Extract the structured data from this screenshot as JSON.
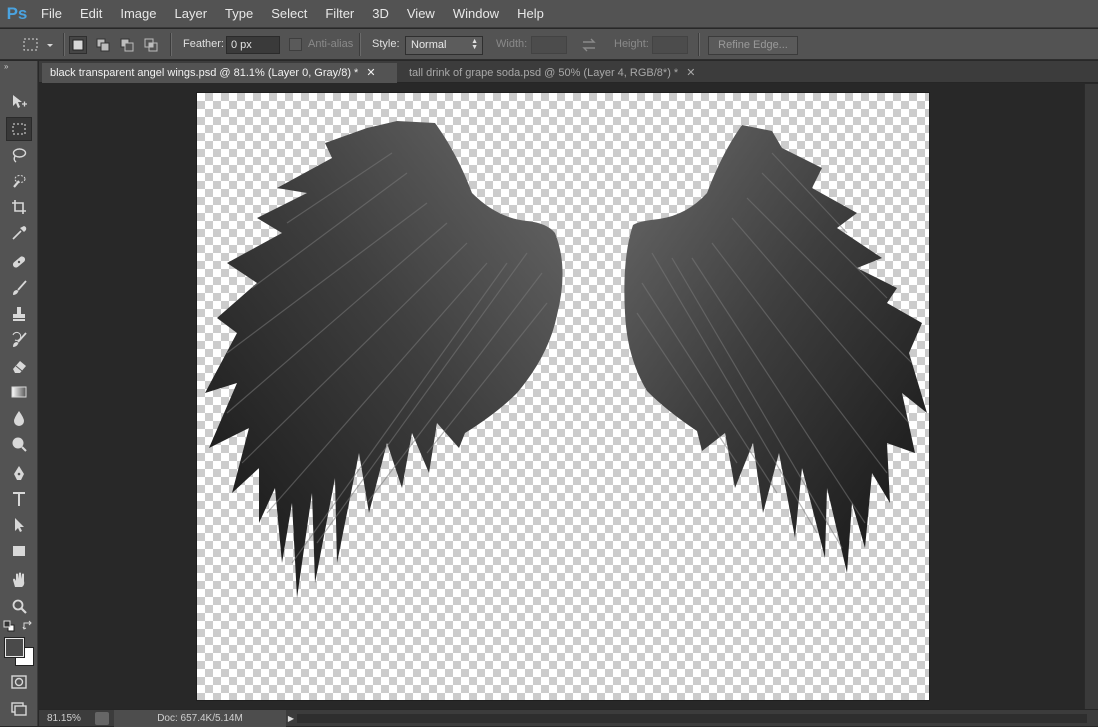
{
  "app": {
    "logo": "Ps"
  },
  "menu": [
    "File",
    "Edit",
    "Image",
    "Layer",
    "Type",
    "Select",
    "Filter",
    "3D",
    "View",
    "Window",
    "Help"
  ],
  "options": {
    "feather_label": "Feather:",
    "feather_value": "0 px",
    "antialias_label": "Anti-alias",
    "style_label": "Style:",
    "style_value": "Normal",
    "width_label": "Width:",
    "height_label": "Height:",
    "refine_edge_label": "Refine Edge..."
  },
  "tabs": [
    {
      "label": "black transparent angel wings.psd @ 81.1% (Layer 0, Gray/8) *",
      "active": true
    },
    {
      "label": "tall drink of grape soda.psd @ 50% (Layer 4, RGB/8*) *",
      "active": false
    }
  ],
  "tools": [
    "move-icon",
    "rectangular-marquee-icon",
    "lasso-icon",
    "quick-selection-icon",
    "crop-icon",
    "eyedropper-icon",
    "spot-healing-icon",
    "brush-icon",
    "clone-stamp-icon",
    "history-brush-icon",
    "eraser-icon",
    "gradient-icon",
    "blur-icon",
    "dodge-icon",
    "pen-icon",
    "type-icon",
    "path-selection-icon",
    "rectangle-icon",
    "hand-icon",
    "zoom-icon"
  ],
  "colors": {
    "foreground": "#4a4a4a",
    "background": "#ffffff",
    "ui_gray": "#535353",
    "canvas_bg": "#282828"
  },
  "status": {
    "zoom": "81.15%",
    "doc": "Doc: 657.4K/5.14M"
  }
}
